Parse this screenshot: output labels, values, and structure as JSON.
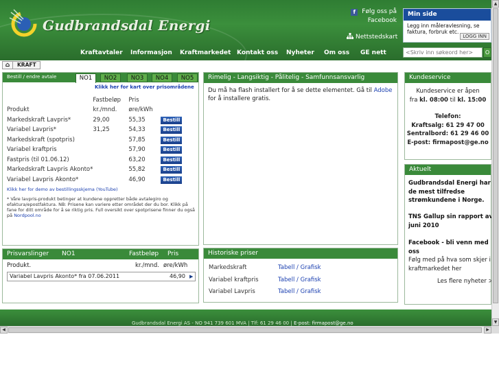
{
  "header": {
    "logo_text": "Gudbrandsdal Energi",
    "facebook_line1": "Følg oss på",
    "facebook_line2": "Facebook",
    "sitemap": "Nettstedskart",
    "search_placeholder": "<Skriv inn søkeord her>",
    "search_button": "O",
    "nav": [
      "Kraftavtaler",
      "Informasjon",
      "Kraftmarkedet",
      "Kontakt oss",
      "Nyheter",
      "Om oss",
      "GE nett"
    ]
  },
  "min_side": {
    "title": "Min side",
    "text": "Legg inn måleravlesning, se faktura, forbruk etc.",
    "login": "LOGG INN"
  },
  "breadcrumb": {
    "current": "KRAFT"
  },
  "price_box": {
    "bestill_label": "Bestill / endre avtale",
    "tabs": [
      "NO1",
      "NO2",
      "NO3",
      "NO4",
      "NO5"
    ],
    "active_tab": "NO1",
    "map_link": "Klikk her for kart over prisområdene",
    "header_product": "Produkt",
    "header_fixed": [
      "Fastbeløp",
      "kr./mnd."
    ],
    "header_price": [
      "Pris",
      "øre/kWh"
    ],
    "order_label": "Bestill",
    "rows": [
      {
        "product": "Markedskraft Lavpris*",
        "fixed": "29,00",
        "price": "55,35"
      },
      {
        "product": "Variabel Lavpris*",
        "fixed": "31,25",
        "price": "54,33"
      },
      {
        "product": "Markedskraft (spotpris)",
        "fixed": "",
        "price": "57,85"
      },
      {
        "product": "Variabel kraftpris",
        "fixed": "",
        "price": "57,90"
      },
      {
        "product": "Fastpris (til 01.06.12)",
        "fixed": "",
        "price": "63,20"
      },
      {
        "product": "Markedskraft Lavpris Akonto*",
        "fixed": "",
        "price": "55,82"
      },
      {
        "product": "Variabel Lavpris Akonto*",
        "fixed": "",
        "price": "46,90"
      }
    ],
    "demo_link": "Klikk her for demo av bestillingsskjema (YouTube)",
    "disclaimer": "* Våre lavpris-produkt betinger at kundene oppretter både avtalegiro og efaktura/epostfaktura. NB: Prisene kan variere etter området der du bor. Klikk på fane for ditt område for å se riktig pris. Full oversikt over spotprisene finner du også på",
    "nordpool": "Nordpool.no"
  },
  "varsling": {
    "title": "Prisvarslinger",
    "area": "NO1",
    "col_fixed": "Fastbeløp",
    "col_price": "Pris",
    "product_label": "Produkt.",
    "unit_fixed": "kr./mnd.",
    "unit_price": "øre/kWh",
    "selected": "Variabel Lavpris Akonto* fra 07.06.2011",
    "selected_price": "46,90"
  },
  "flash_box": {
    "title": "Rimelig - Langsiktig - Pålitelig - Samfunnsansvarlig",
    "text_before": "Du må ha flash installert for å se dette elementet. Gå til ",
    "adobe": "Adobe",
    "text_after": " for å installere gratis."
  },
  "history_box": {
    "title": "Historiske priser",
    "rows": [
      {
        "label": "Markedskraft",
        "links": "Tabell / Grafisk"
      },
      {
        "label": "Variabel kraftpris",
        "links": "Tabell / Grafisk"
      },
      {
        "label": "Variabel Lavpris",
        "links": "Tabell / Grafisk"
      }
    ]
  },
  "kundeservice": {
    "title": "Kundeservice",
    "line1": "Kundeservice er åpen",
    "line2_pre": "fra ",
    "line2_from": "kl. 08:00",
    "line2_mid": " til ",
    "line2_to": "kl. 15:00",
    "phone_label": "Telefon:",
    "kraftsalg": "Kraftsalg: 61 29 47 00",
    "sentralbord": "Sentralbord: 61 29 46 00",
    "epost": "E-post: firmapost@ge.no"
  },
  "aktuelt": {
    "title": "Aktuelt",
    "news1": "Gudbrandsdal Energi har de mest tilfredse strømkundene i Norge.",
    "news2": "TNS Gallup sin rapport av juni 2010",
    "news3_title": "Facebook - bli venn med oss",
    "news3_text": "Følg med på hva som skjer i kraftmarkedet her",
    "more": "Les flere nyheter >>"
  },
  "footer": {
    "text": "Gudbrandsdal Energi AS - NO 941 739 601 MVA | Tlf: 61 29 46 00 | ",
    "email": "E-post: firmapost@ge.no"
  },
  "colors": {
    "brand_green": "#3a8a3a",
    "min_side_blue": "#1a4d9c",
    "link_blue": "#1a3fb0"
  }
}
